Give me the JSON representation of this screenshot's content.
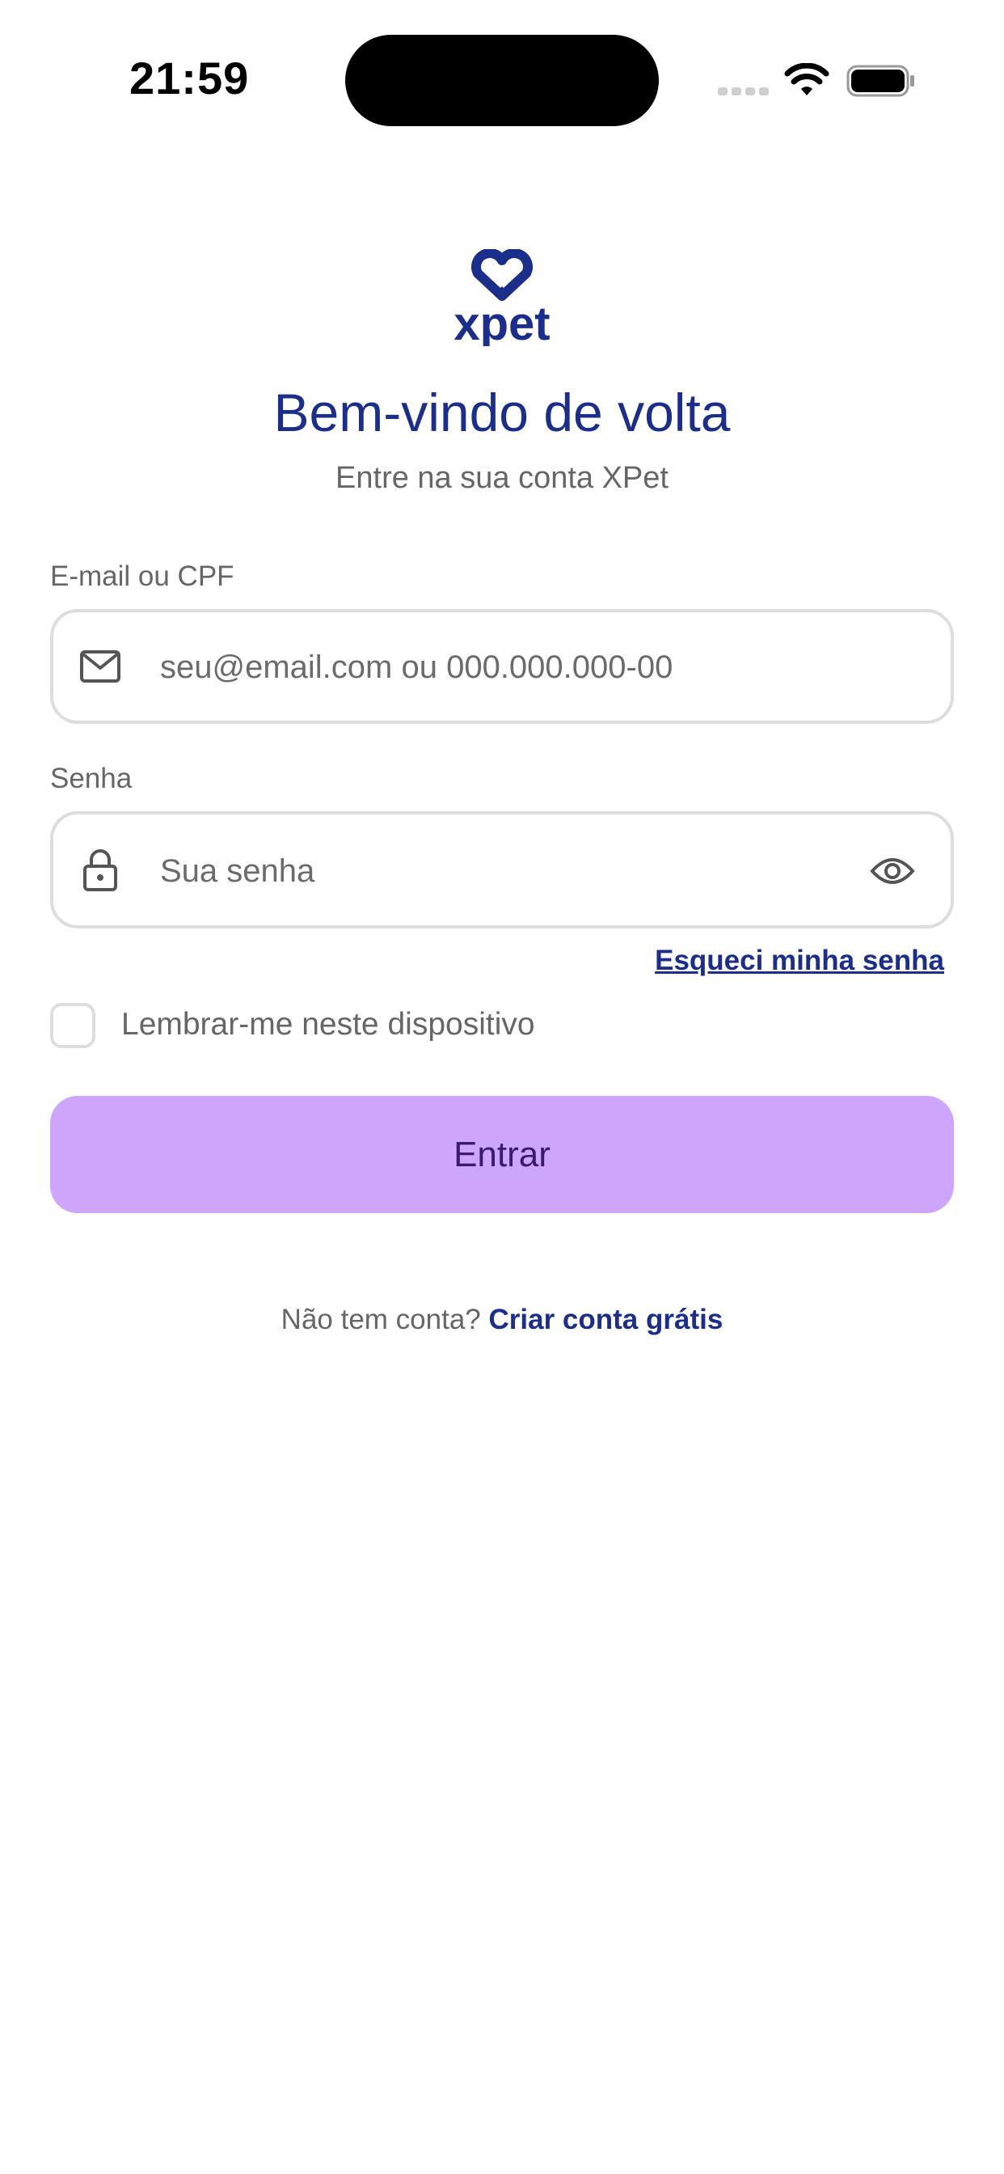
{
  "status_bar": {
    "time": "21:59",
    "icons": [
      "signal-icon",
      "wifi-icon",
      "battery-icon"
    ]
  },
  "brand": {
    "logo_text": "xpet",
    "color": "#1b2e8c"
  },
  "header": {
    "title": "Bem-vindo de volta",
    "subtitle": "Entre na sua conta XPet"
  },
  "form": {
    "email": {
      "label": "E-mail ou CPF",
      "placeholder": "seu@email.com ou 000.000.000-00",
      "value": "",
      "icon": "mail-icon"
    },
    "password": {
      "label": "Senha",
      "placeholder": "Sua senha",
      "value": "",
      "icon": "lock-icon",
      "toggle_icon": "eye-icon"
    },
    "forgot_label": "Esqueci minha senha",
    "remember_label": "Lembrar-me neste dispositivo",
    "remember_checked": false,
    "submit_label": "Entrar"
  },
  "signup": {
    "prompt": "Não tem conta?",
    "link": "Criar conta grátis"
  },
  "colors": {
    "primary_text": "#1b2e8c",
    "button_bg": "#cda6fc",
    "button_text": "#3b1a6e",
    "muted_text": "#666666",
    "border": "#dddddd"
  }
}
